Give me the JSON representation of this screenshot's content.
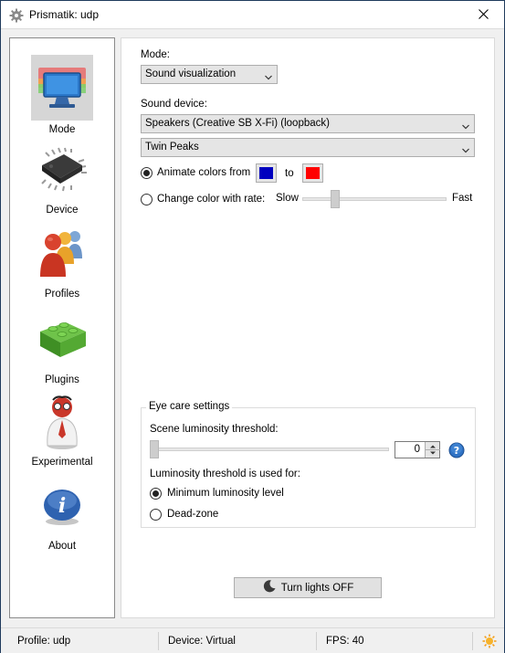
{
  "window": {
    "title": "Prismatik: udp",
    "title_icon": "gear-icon",
    "close_icon": "close-icon"
  },
  "sidebar": {
    "items": [
      {
        "label": "Mode",
        "icon": "monitor-icon",
        "selected": true
      },
      {
        "label": "Device",
        "icon": "chip-icon",
        "selected": false
      },
      {
        "label": "Profiles",
        "icon": "people-icon",
        "selected": false
      },
      {
        "label": "Plugins",
        "icon": "lego-brick-icon",
        "selected": false
      },
      {
        "label": "Experimental",
        "icon": "scientist-icon",
        "selected": false
      },
      {
        "label": "About",
        "icon": "info-icon",
        "selected": false
      }
    ]
  },
  "mode_panel": {
    "mode_label": "Mode:",
    "mode_value": "Sound visualization",
    "sound_device_label": "Sound device:",
    "sound_device_value": "Speakers (Creative SB X-Fi) (loopback)",
    "visualizer_value": "Twin Peaks",
    "animate_colors_label": "Animate colors from",
    "animate_colors_selected": true,
    "color_from": "#0000bf",
    "to_label": "to",
    "color_to": "#ff0000",
    "change_color_label": "Change color with rate:",
    "change_color_selected": false,
    "rate_slow_label": "Slow",
    "rate_fast_label": "Fast",
    "rate_value_fraction": 0.21
  },
  "eye_care": {
    "title": "Eye care settings",
    "threshold_label": "Scene luminosity threshold:",
    "threshold_value": "0",
    "threshold_fraction": 0.0,
    "used_for_label": "Luminosity threshold is used for:",
    "option_min_label": "Minimum luminosity level",
    "option_min_selected": true,
    "option_dead_label": "Dead-zone",
    "option_dead_selected": false,
    "help_icon": "help-icon"
  },
  "lights_button": {
    "label": "Turn lights OFF",
    "icon": "moon-icon"
  },
  "statusbar": {
    "profile": "Profile: udp",
    "device": "Device: Virtual",
    "fps": "FPS: 40",
    "state_icon": "sun-icon"
  }
}
